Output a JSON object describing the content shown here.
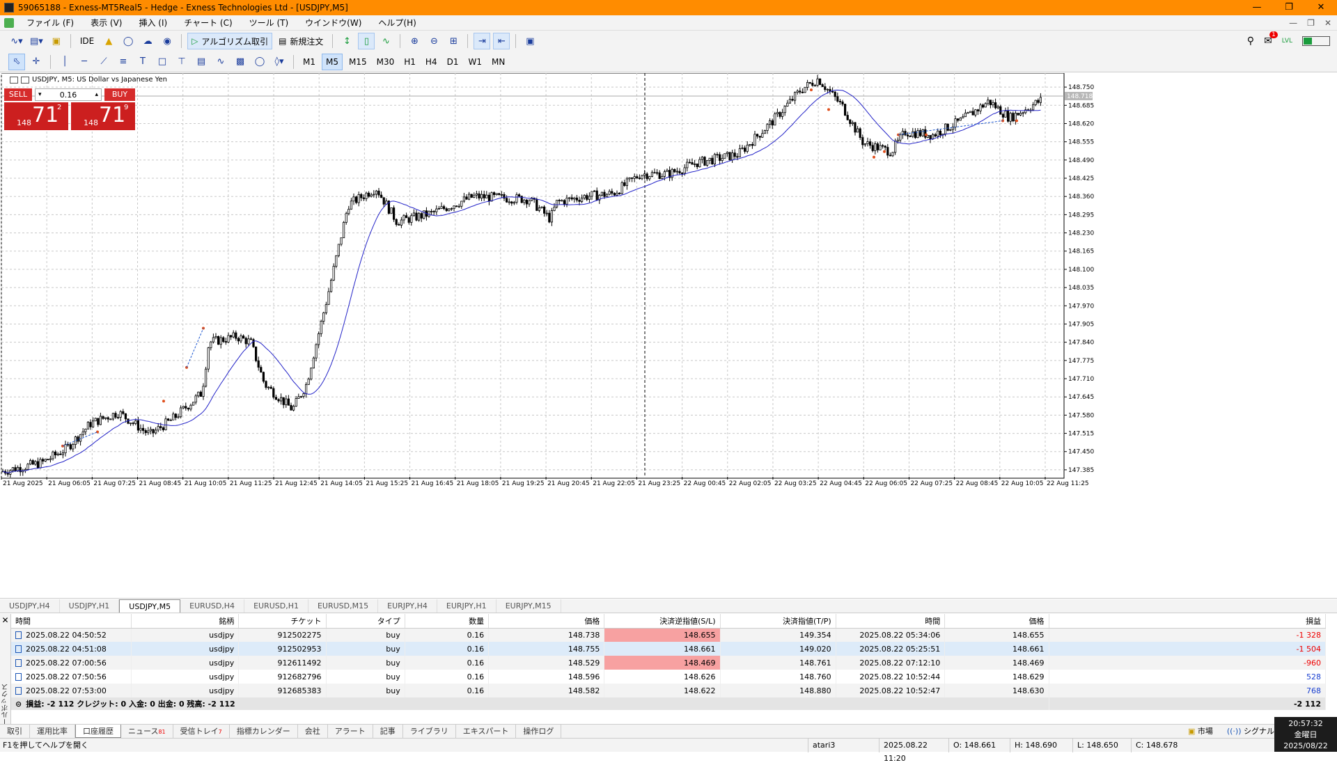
{
  "title": "59065188 - Exness-MT5Real5 - Hedge - Exness Technologies Ltd - [USDJPY,M5]",
  "menu": [
    "ファイル (F)",
    "表示 (V)",
    "挿入 (I)",
    "チャート (C)",
    "ツール (T)",
    "ウインドウ(W)",
    "ヘルプ(H)"
  ],
  "toolbar": {
    "ide": "IDE",
    "algo": "アルゴリズム取引",
    "neworder": "新規注文",
    "notif_count": "1",
    "lvl": "LVL"
  },
  "timeframes": [
    "M1",
    "M5",
    "M15",
    "M30",
    "H1",
    "H4",
    "D1",
    "W1",
    "MN"
  ],
  "active_timeframe": "M5",
  "chart": {
    "symbol_label": "USDJPY, M5:  US Dollar vs Japanese Yen",
    "sell": "SELL",
    "buy": "BUY",
    "lot": "0.16",
    "sell_price": {
      "small": "148",
      "big": "71",
      "sup": "2"
    },
    "buy_price": {
      "small": "148",
      "big": "71",
      "sup": "9"
    },
    "current_price": "148.718",
    "price_labels": [
      "148.750",
      "148.685",
      "148.620",
      "148.555",
      "148.490",
      "148.425",
      "148.360",
      "148.295",
      "148.230",
      "148.165",
      "148.100",
      "148.035",
      "147.970",
      "147.905",
      "147.840",
      "147.775",
      "147.710",
      "147.645",
      "147.580",
      "147.515",
      "147.450",
      "147.385"
    ],
    "time_labels": [
      "21 Aug 2025",
      "21 Aug 06:05",
      "21 Aug 07:25",
      "21 Aug 08:45",
      "21 Aug 10:05",
      "21 Aug 11:25",
      "21 Aug 12:45",
      "21 Aug 14:05",
      "21 Aug 15:25",
      "21 Aug 16:45",
      "21 Aug 18:05",
      "21 Aug 19:25",
      "21 Aug 20:45",
      "21 Aug 22:05",
      "21 Aug 23:25",
      "22 Aug 00:45",
      "22 Aug 02:05",
      "22 Aug 03:25",
      "22 Aug 04:45",
      "22 Aug 06:05",
      "22 Aug 07:25",
      "22 Aug 08:45",
      "22 Aug 10:05",
      "22 Aug 11:25"
    ],
    "colors": {
      "bull": "#000000",
      "bear": "#000000",
      "ma": "#2323c8",
      "grid": "#c8c8c8"
    }
  },
  "chart_tabs": [
    "USDJPY,H4",
    "USDJPY,H1",
    "USDJPY,M5",
    "EURUSD,H4",
    "EURUSD,H1",
    "EURUSD,M15",
    "EURJPY,H4",
    "EURJPY,H1",
    "EURJPY,M15"
  ],
  "active_chart_tab": "USDJPY,M5",
  "history": {
    "headers": [
      "時間",
      "銘柄",
      "チケット",
      "タイプ",
      "数量",
      "価格",
      "決済逆指値(S/L)",
      "決済指値(T/P)",
      "時間",
      "価格",
      "損益"
    ],
    "rows": [
      [
        "2025.08.22 04:50:52",
        "usdjpy",
        "912502275",
        "buy",
        "0.16",
        "148.738",
        "148.655",
        "149.354",
        "2025.08.22 05:34:06",
        "148.655",
        "-1 328"
      ],
      [
        "2025.08.22 04:51:08",
        "usdjpy",
        "912502953",
        "buy",
        "0.16",
        "148.755",
        "148.661",
        "149.020",
        "2025.08.22 05:25:51",
        "148.661",
        "-1 504"
      ],
      [
        "2025.08.22 07:00:56",
        "usdjpy",
        "912611492",
        "buy",
        "0.16",
        "148.529",
        "148.469",
        "148.761",
        "2025.08.22 07:12:10",
        "148.469",
        "-960"
      ],
      [
        "2025.08.22 07:50:56",
        "usdjpy",
        "912682796",
        "buy",
        "0.16",
        "148.596",
        "148.626",
        "148.760",
        "2025.08.22 10:52:44",
        "148.629",
        "528"
      ],
      [
        "2025.08.22 07:53:00",
        "usdjpy",
        "912685383",
        "buy",
        "0.16",
        "148.582",
        "148.622",
        "148.880",
        "2025.08.22 10:52:47",
        "148.630",
        "768"
      ]
    ],
    "summary": "損益: -2 112  クレジット: 0  入金: 0  出金: 0  残高: -2 112",
    "summary_total": "-2 112"
  },
  "toolbox_label": "ツールボックス",
  "bottom_tabs": [
    "取引",
    "運用比率",
    "口座履歴",
    "ニュース",
    "受信トレイ",
    "指標カレンダー",
    "会社",
    "アラート",
    "記事",
    "ライブラリ",
    "エキスパート",
    "操作ログ"
  ],
  "bottom_tab_subs": {
    "news": "81",
    "inbox": "7"
  },
  "active_bottom_tab": "口座履歴",
  "bottom_right": {
    "market": "市場",
    "signals": "シグナル"
  },
  "status": {
    "help": "F1を押してヘルプを開く",
    "profile": "atari3",
    "datetime": "2025.08.22 11:20",
    "open": "O: 148.661",
    "high": "H: 148.690",
    "low": "L: 148.650",
    "close": "C: 148.678"
  },
  "clock": {
    "time": "20:57:32",
    "day": "金曜日",
    "date": "2025/08/22"
  }
}
